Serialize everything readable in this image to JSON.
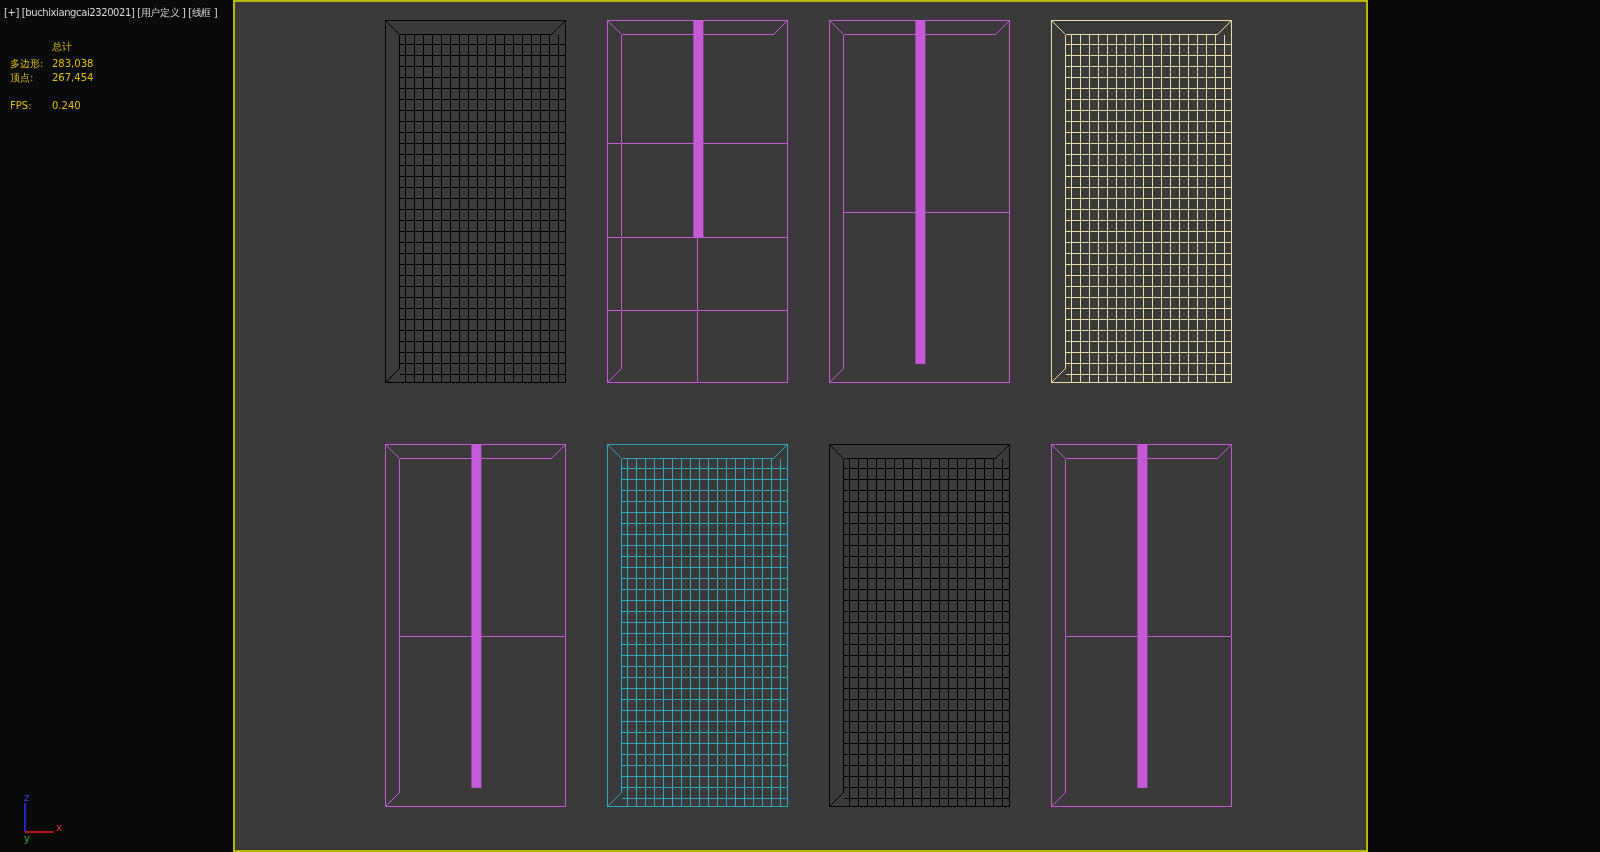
{
  "viewport": {
    "label": "[+]  [buchixiangcai2320021]  [用户定义 ]  [线框 ]"
  },
  "stats": {
    "heading": "总计",
    "rows": [
      {
        "label": "多边形:",
        "value": "283,038"
      },
      {
        "label": "顶点:",
        "value": "267,454"
      }
    ],
    "fps_label": "FPS:",
    "fps_value": "0.240"
  },
  "axis": {
    "x": "x",
    "y": "y",
    "z": "z"
  },
  "fridges": [
    {
      "kind": "mesh",
      "color": "#000000"
    },
    {
      "kind": "french",
      "color": "#c45ad6"
    },
    {
      "kind": "side",
      "color": "#c45ad6"
    },
    {
      "kind": "mesh",
      "color": "#e8dcaa"
    },
    {
      "kind": "side",
      "color": "#c45ad6"
    },
    {
      "kind": "mesh",
      "color": "#2fa6c4"
    },
    {
      "kind": "mesh",
      "color": "#000000"
    },
    {
      "kind": "side",
      "color": "#c45ad6"
    }
  ]
}
